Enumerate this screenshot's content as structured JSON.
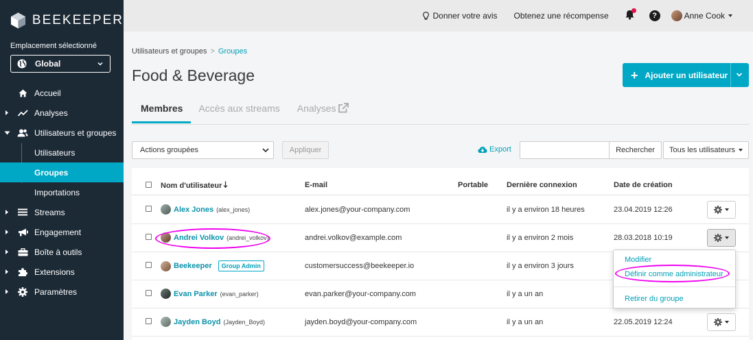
{
  "sidebar": {
    "logo": "BEEKEEPER",
    "location_label": "Emplacement sélectionné",
    "location_value": "Global",
    "items": [
      {
        "label": "Accueil"
      },
      {
        "label": "Analyses"
      },
      {
        "label": "Utilisateurs et groupes"
      },
      {
        "label": "Utilisateurs"
      },
      {
        "label": "Groupes"
      },
      {
        "label": "Importations"
      },
      {
        "label": "Streams"
      },
      {
        "label": "Engagement"
      },
      {
        "label": "Boîte à outils"
      },
      {
        "label": "Extensions"
      },
      {
        "label": "Paramètres"
      }
    ]
  },
  "topbar": {
    "feedback": "Donner votre avis",
    "reward": "Obtenez une récompense",
    "user": "Anne Cook",
    "notification_color": "#e0154d"
  },
  "breadcrumb": {
    "parent": "Utilisateurs et groupes",
    "sep": ">",
    "current": "Groupes"
  },
  "page_title": "Food & Beverage",
  "add_button": "Ajouter un utilisateur",
  "tabs": [
    {
      "label": "Membres",
      "active": true
    },
    {
      "label": "Accès aux streams",
      "active": false
    },
    {
      "label": "Analyses",
      "active": false
    }
  ],
  "toolbar": {
    "bulk_actions": "Actions groupées",
    "apply": "Appliquer",
    "export": "Export",
    "search_placeholder": "",
    "search_button": "Rechercher",
    "filter": "Tous les utilisateurs"
  },
  "table": {
    "columns": [
      "Nom d'utilisateur",
      "E-mail",
      "Portable",
      "Dernière connexion",
      "Date de création"
    ],
    "rows": [
      {
        "name": "Alex Jones",
        "handle": "(alex_jones)",
        "email": "alex.jones@your-company.com",
        "last": "il y a environ 18 heures",
        "created": "23.04.2019 12:26"
      },
      {
        "name": "Andrei Volkov",
        "handle": "(andrei_volkov)",
        "email": "andrei.volkov@example.com",
        "last": "il y a environ 2 mois",
        "created": "28.03.2018 10:19"
      },
      {
        "name": "Beekeeper",
        "badge": "Group Admin",
        "email": "customersuccess@beekeeper.io",
        "last": "il y a environ 3 jours",
        "created": ""
      },
      {
        "name": "Evan Parker",
        "handle": "(evan_parker)",
        "email": "evan.parker@your-company.com",
        "last": "il y a un an",
        "created": ""
      },
      {
        "name": "Jayden Boyd",
        "handle": "(Jayden_Boyd)",
        "email": "jayden.boyd@your-company.com",
        "last": "il y a un an",
        "created": "22.05.2019 12:24"
      }
    ]
  },
  "row_menu": {
    "edit": "Modifier",
    "make_admin": "Définir comme administrateur",
    "remove": "Retirer du groupe"
  },
  "colors": {
    "accent": "#00a8c6",
    "sidebar": "#1c2a36",
    "highlight": "#f000f0"
  }
}
